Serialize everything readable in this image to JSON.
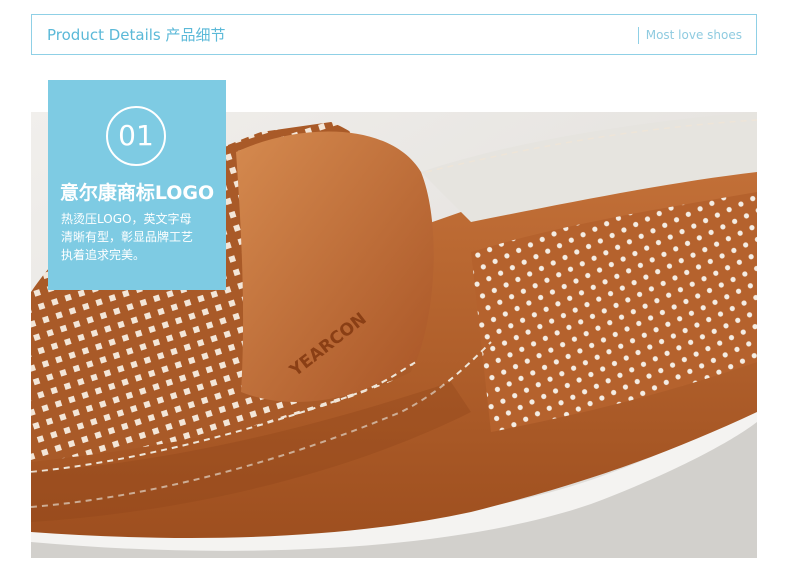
{
  "header": {
    "title": "Product Details 产品细节",
    "tagline": "Most love shoes"
  },
  "feature": {
    "number": "01",
    "title": "意尔康商标LOGO",
    "description_lines": [
      "热烫压LOGO，英文字母",
      "清晰有型，彰显品牌工艺",
      "执着追求完美。"
    ]
  },
  "photo": {
    "brand_emboss": "YEARCON"
  },
  "colors": {
    "accent": "#7ecbe3",
    "header_text": "#5bb9d8",
    "leather": "#b8612a"
  }
}
